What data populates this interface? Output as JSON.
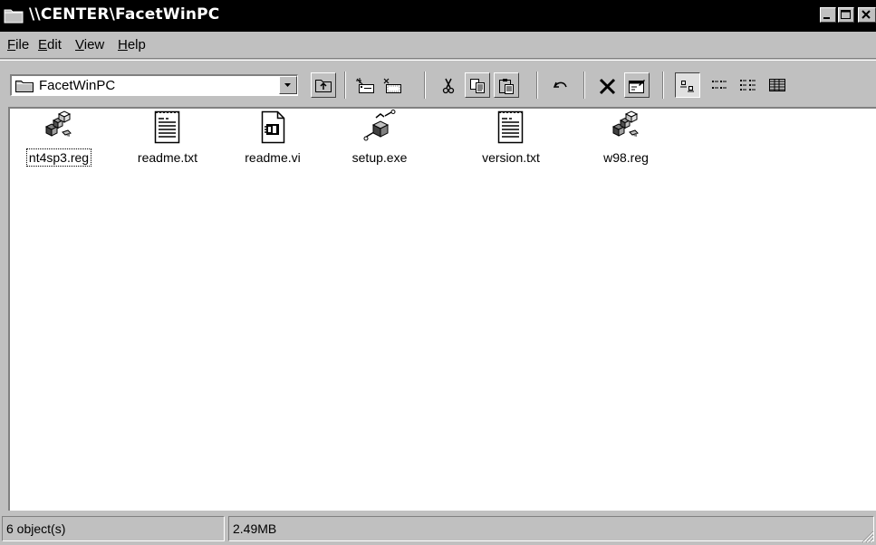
{
  "window": {
    "title": "\\\\CENTER\\FacetWinPC"
  },
  "menu": [
    {
      "pre": "",
      "key": "F",
      "post": "ile"
    },
    {
      "pre": "",
      "key": "E",
      "post": "dit"
    },
    {
      "pre": "",
      "key": "V",
      "post": "iew"
    },
    {
      "pre": "",
      "key": "H",
      "post": "elp"
    }
  ],
  "toolbar": {
    "address_value": "FacetWinPC",
    "buttons": [
      "up-one-level",
      "map-network-drive",
      "disconnect-network-drive",
      "cut",
      "copy",
      "paste",
      "undo",
      "delete",
      "properties",
      "large-icons",
      "small-icons",
      "list",
      "details"
    ]
  },
  "files": [
    {
      "name": "nt4sp3.reg",
      "icon": "registry-icon",
      "selected": true
    },
    {
      "name": "readme.txt",
      "icon": "text-document-icon",
      "selected": false
    },
    {
      "name": "readme.vi",
      "icon": "vi-file-icon",
      "selected": false
    },
    {
      "name": "setup.exe",
      "icon": "setup-exe-icon",
      "selected": false
    },
    {
      "name": "version.txt",
      "icon": "text-document-icon",
      "selected": false
    },
    {
      "name": "w98.reg",
      "icon": "registry-icon",
      "selected": false
    }
  ],
  "status": {
    "objects": "6 object(s)",
    "size": "2.49MB"
  },
  "colors": {
    "titlebar_bg": "#000000",
    "face": "#c0c0c0",
    "content_bg": "#ffffff"
  }
}
